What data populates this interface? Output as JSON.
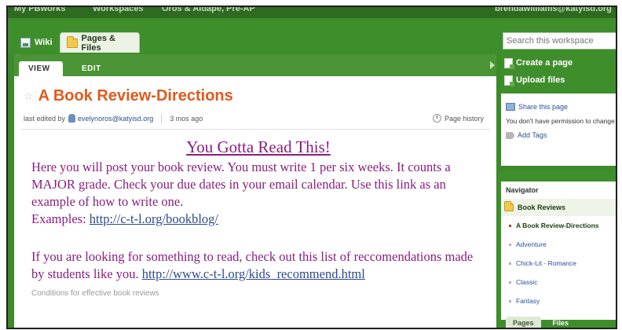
{
  "top_bar": {
    "my_pbworks": "My PBworks",
    "workspaces": "Workspaces",
    "workspace_name": "Oros & Aldape, Pre-AP",
    "user_email": "brendawilliams@katyisd.org"
  },
  "tabs": [
    {
      "label": "Wiki"
    },
    {
      "label": "Pages & Files"
    }
  ],
  "search": {
    "placeholder": "Search this workspace"
  },
  "main": {
    "tabs": [
      {
        "label": "VIEW"
      },
      {
        "label": "EDIT"
      }
    ],
    "title": "A Book Review-Directions",
    "meta": {
      "last_edited_prefix": "last edited by",
      "user": "evelynoros@katyisd.org",
      "time": "3 mos ago",
      "history": "Page history"
    },
    "headline": "You Gotta Read This!",
    "para1": "Here you will post your book review. You must write 1 per six weeks. It counts a MAJOR grade. Check your due dates in your email calendar. Use this link as an example of how to write one.",
    "examples_label": "Examples: ",
    "examples_link": "http://c-t-l.org/bookblog/",
    "para2": "If you are looking for something to read, check out this list of reccomendations made by students like you. ",
    "para2_link": "http://www.c-t-l.org/kids_recommend.html",
    "faded_line": "Conditions for effective book reviews"
  },
  "actions": [
    {
      "label": "Create a page"
    },
    {
      "label": "Upload files"
    }
  ],
  "side": {
    "share": "Share this page",
    "permission_note": "You don't have permission to change",
    "add_tags": "Add Tags"
  },
  "navigator": {
    "heading": "Navigator",
    "folder": "Book Reviews",
    "items": [
      "A Book Review-Directions",
      "Adventure",
      "Chick-Lit - Romance",
      "Classic",
      "Fantasy"
    ],
    "tabs": [
      "Pages",
      "Files"
    ]
  }
}
